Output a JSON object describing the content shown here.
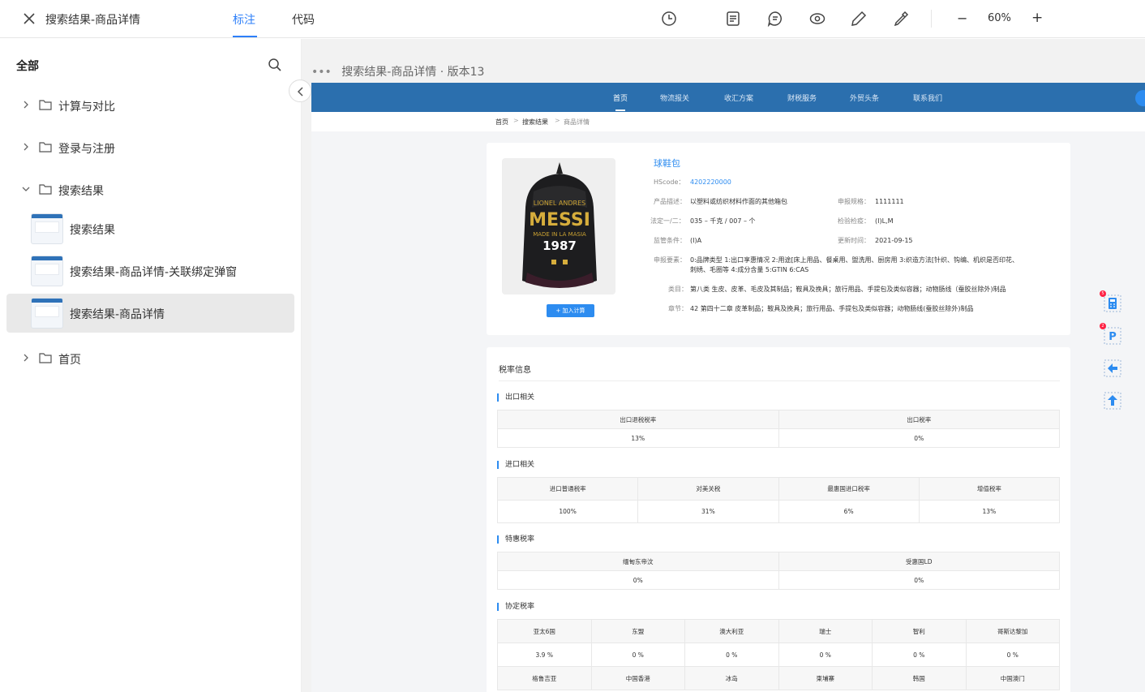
{
  "header": {
    "title": "搜索结果-商品详情",
    "tabs": [
      {
        "label": "标注",
        "active": true
      },
      {
        "label": "代码",
        "active": false
      }
    ],
    "tools": [
      "clock-icon",
      "document-icon",
      "comment-icon",
      "eye-icon",
      "pen-icon",
      "eyedropper-icon"
    ],
    "zoom_minus": "−",
    "zoom": "60%",
    "zoom_plus": "+"
  },
  "sidebar": {
    "heading": "全部",
    "items": [
      {
        "type": "folder",
        "label": "计算与对比",
        "expanded": false
      },
      {
        "type": "folder",
        "label": "登录与注册",
        "expanded": false
      },
      {
        "type": "folder",
        "label": "搜索结果",
        "expanded": true
      },
      {
        "type": "page",
        "label": "搜索结果"
      },
      {
        "type": "page",
        "label": "搜索结果-商品详情-关联绑定弹窗"
      },
      {
        "type": "page",
        "label": "搜索结果-商品详情",
        "selected": true
      },
      {
        "type": "folder",
        "label": "首页",
        "expanded": false
      }
    ]
  },
  "canvas": {
    "dots": "•••",
    "title": "搜索结果-商品详情 · 版本13"
  },
  "site": {
    "nav": [
      "首页",
      "物流报关",
      "收汇方案",
      "财税服务",
      "外贸头条",
      "联系我们"
    ],
    "nav_active": 0,
    "breadcrumb": [
      "首页",
      "搜索结果",
      "商品详情"
    ],
    "crumb_sep": ">",
    "product": {
      "name": "球鞋包",
      "add_button": "+ 加入计算",
      "image_texts": [
        "LIONEL ANDRES",
        "MESSI",
        "MADE IN LA MASIA",
        "1987"
      ],
      "fields": {
        "hscode_k": "HScode：",
        "hscode_v": "4202220000",
        "desc_k": "产品描述：",
        "desc_v": "以塑料或纺织材料作面的其他箱包",
        "spec_k": "申报规格：",
        "spec_v": "1111111",
        "unit_k": "法定一/二：",
        "unit_v": "035 – 千克 / 007 – 个",
        "inspect_k": "检验检疫：",
        "inspect_v": "(I)L,M",
        "super_k": "监管条件：",
        "super_v": "(I)A",
        "update_k": "更新时间：",
        "update_v": "2021-09-15",
        "elem_k": "申报要素：",
        "elem_v1": "0:品牌类型  1:出口享惠情况  2:用途[床上用品、餐桌用、盥洗用、厨房用   3:织造方法[针织、钩编、机织是否印花、",
        "elem_v2": "刺绣、毛圈等   4:成分含量 5:GTIN 6:CAS",
        "class_k": "类目：",
        "class_v": "第八类 生皮、皮革、毛皮及其制品；鞍具及挽具；旅行用品、手提包及类似容器；动物肠线（蚕胶丝除外)制品",
        "chapter_k": "章节：",
        "chapter_v": "42 第四十二章 皮革制品；鞍具及挽具；旅行用品、手提包及类似容器；动物肠线(蚕胶丝除外)制品"
      }
    },
    "rates": {
      "title": "税率信息",
      "export": {
        "label": "出口相关",
        "headers": [
          "出口退税税率",
          "出口税率"
        ],
        "values": [
          "13%",
          "0%"
        ]
      },
      "import": {
        "label": "进口相关",
        "headers": [
          "进口普通税率",
          "对美关税",
          "最惠国进口税率",
          "增值税率"
        ],
        "values": [
          "100%",
          "31%",
          "6%",
          "13%"
        ]
      },
      "special": {
        "label": "特惠税率",
        "headers": [
          "缅甸东帝汶",
          "受惠国LD"
        ],
        "values": [
          "0%",
          "0%"
        ]
      },
      "agreement": {
        "label": "协定税率",
        "headers": [
          "亚太6国",
          "东盟",
          "澳大利亚",
          "瑞士",
          "智利",
          "哥斯达黎加"
        ],
        "values": [
          "3.9 %",
          "0 %",
          "0 %",
          "0 %",
          "0 %",
          "0 %"
        ],
        "headers2": [
          "格鲁吉亚",
          "中国香港",
          "冰岛",
          "柬埔寨",
          "韩国",
          "中国澳门"
        ]
      }
    },
    "float_tools": [
      {
        "icon": "calculator-icon",
        "badge": "5"
      },
      {
        "icon": "parking-icon",
        "badge": "2"
      },
      {
        "icon": "arrow-left-icon",
        "badge": ""
      },
      {
        "icon": "arrow-up-icon",
        "badge": ""
      }
    ]
  }
}
